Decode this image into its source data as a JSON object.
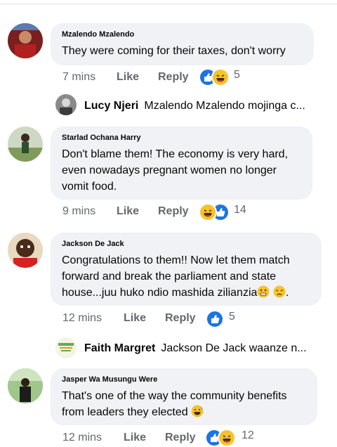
{
  "comments": [
    {
      "author": "Mzalendo Mzalendo",
      "text": "They were coming for their taxes, don't worry",
      "time": "7 mins",
      "like": "Like",
      "reply": "Reply",
      "reaction_count": "5",
      "reaction_icons": [
        "like-icon",
        "haha-icon"
      ]
    },
    {
      "author": "Starlad Ochana Harry",
      "text_lines": [
        "Don't blame them! The economy is very hard,",
        "even nowadays pregnant women no longer",
        "vomit food."
      ],
      "time": "9 mins",
      "like": "Like",
      "reply": "Reply",
      "reaction_count": "14",
      "reaction_icons": [
        "haha-icon",
        "like-icon"
      ]
    },
    {
      "author": "Jackson De Jack",
      "text_lines": [
        "Congratulations to them!! Now let them match",
        "forward and break the parliament and state",
        "house...juu huko ndio mashida zilianzia"
      ],
      "text_suffix": ".",
      "time": "12 mins",
      "like": "Like",
      "reply": "Reply",
      "reaction_count": "5",
      "reaction_icons": [
        "like-icon"
      ]
    },
    {
      "author": "Jasper Wa Musungu Were",
      "text_lines": [
        "That's one of the way the community benefits",
        "from leaders they elected"
      ],
      "time": "12 mins",
      "like": "Like",
      "reply": "Reply",
      "reaction_count": "12",
      "reaction_icons": [
        "like-icon",
        "haha-icon"
      ]
    }
  ],
  "replies": [
    {
      "author": "Lucy Njeri",
      "text": "Mzalendo Mzalendo mojinga c..."
    },
    {
      "author": "Faith Margret",
      "text": "Jackson De Jack waanze n..."
    }
  ],
  "colors": {
    "bubble": "#f0f2f5",
    "meta": "#65676b",
    "like": "#1b74e4",
    "haha": "#f7c22b"
  }
}
